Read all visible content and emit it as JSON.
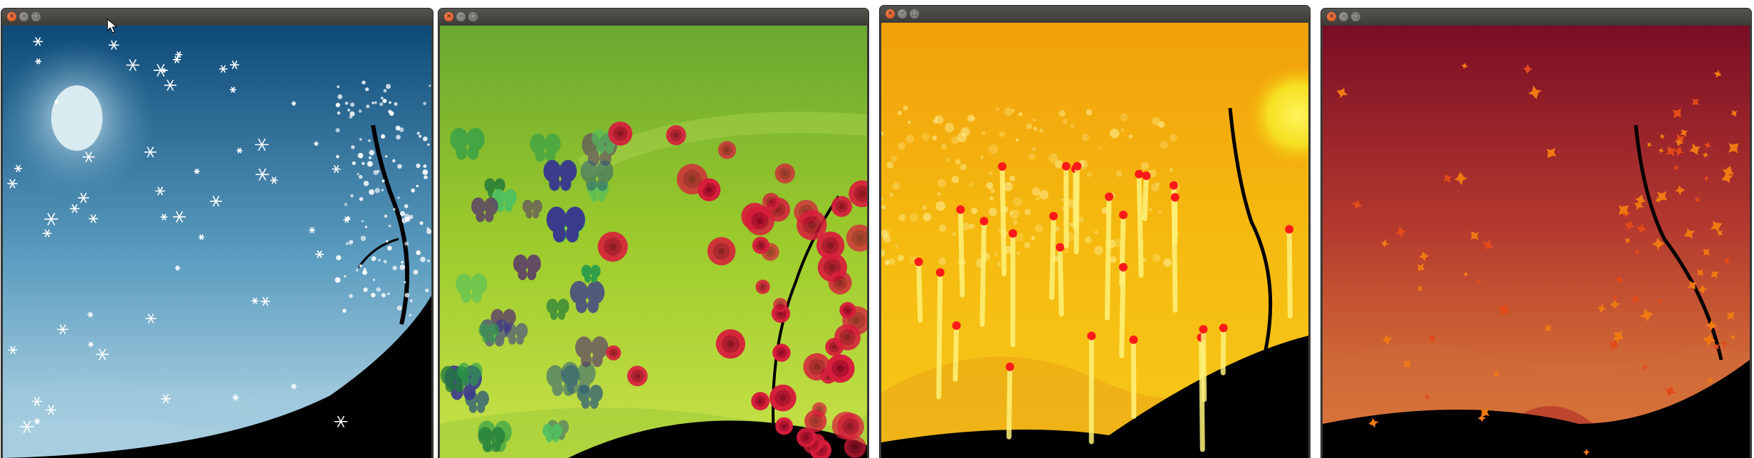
{
  "windows": [
    {
      "name": "winter",
      "title_buttons": [
        "close",
        "minimize",
        "maximize"
      ],
      "season": "winter",
      "sky_colors": [
        "#0e4a78",
        "#5e9ec1",
        "#bcdbe8"
      ],
      "particle": "snowflake"
    },
    {
      "name": "spring",
      "title_buttons": [
        "close",
        "minimize",
        "maximize"
      ],
      "season": "spring",
      "sky_colors": [
        "#6aa830",
        "#9ccb2c",
        "#c9e24a"
      ],
      "particle": "butterfly-and-rose"
    },
    {
      "name": "summer",
      "title_buttons": [
        "close",
        "minimize",
        "maximize"
      ],
      "season": "summer",
      "sky_colors": [
        "#f1a00a",
        "#f5ba10",
        "#f7c81a"
      ],
      "particle": "firework-trail"
    },
    {
      "name": "autumn",
      "title_buttons": [
        "close",
        "minimize",
        "maximize"
      ],
      "season": "autumn",
      "sky_colors": [
        "#7a0d25",
        "#b2372e",
        "#e58a3a"
      ],
      "particle": "maple-leaf"
    }
  ],
  "titlebar_icons": {
    "close": "close-icon",
    "minimize": "minimize-icon",
    "maximize": "maximize-icon"
  },
  "pointer": "mouse-pointer-icon"
}
